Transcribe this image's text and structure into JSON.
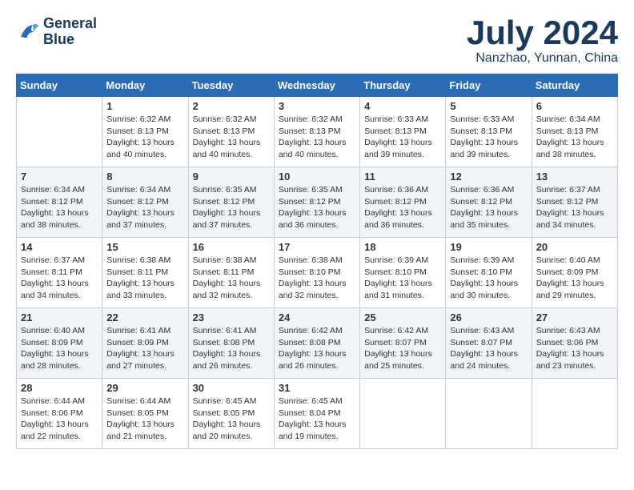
{
  "header": {
    "logo": {
      "line1": "General",
      "line2": "Blue"
    },
    "month": "July 2024",
    "location": "Nanzhao, Yunnan, China"
  },
  "days_of_week": [
    "Sunday",
    "Monday",
    "Tuesday",
    "Wednesday",
    "Thursday",
    "Friday",
    "Saturday"
  ],
  "weeks": [
    [
      {
        "day": "",
        "sunrise": "",
        "sunset": "",
        "daylight": ""
      },
      {
        "day": "1",
        "sunrise": "Sunrise: 6:32 AM",
        "sunset": "Sunset: 8:13 PM",
        "daylight": "Daylight: 13 hours and 40 minutes."
      },
      {
        "day": "2",
        "sunrise": "Sunrise: 6:32 AM",
        "sunset": "Sunset: 8:13 PM",
        "daylight": "Daylight: 13 hours and 40 minutes."
      },
      {
        "day": "3",
        "sunrise": "Sunrise: 6:32 AM",
        "sunset": "Sunset: 8:13 PM",
        "daylight": "Daylight: 13 hours and 40 minutes."
      },
      {
        "day": "4",
        "sunrise": "Sunrise: 6:33 AM",
        "sunset": "Sunset: 8:13 PM",
        "daylight": "Daylight: 13 hours and 39 minutes."
      },
      {
        "day": "5",
        "sunrise": "Sunrise: 6:33 AM",
        "sunset": "Sunset: 8:13 PM",
        "daylight": "Daylight: 13 hours and 39 minutes."
      },
      {
        "day": "6",
        "sunrise": "Sunrise: 6:34 AM",
        "sunset": "Sunset: 8:13 PM",
        "daylight": "Daylight: 13 hours and 38 minutes."
      }
    ],
    [
      {
        "day": "7",
        "sunrise": "Sunrise: 6:34 AM",
        "sunset": "Sunset: 8:12 PM",
        "daylight": "Daylight: 13 hours and 38 minutes."
      },
      {
        "day": "8",
        "sunrise": "Sunrise: 6:34 AM",
        "sunset": "Sunset: 8:12 PM",
        "daylight": "Daylight: 13 hours and 37 minutes."
      },
      {
        "day": "9",
        "sunrise": "Sunrise: 6:35 AM",
        "sunset": "Sunset: 8:12 PM",
        "daylight": "Daylight: 13 hours and 37 minutes."
      },
      {
        "day": "10",
        "sunrise": "Sunrise: 6:35 AM",
        "sunset": "Sunset: 8:12 PM",
        "daylight": "Daylight: 13 hours and 36 minutes."
      },
      {
        "day": "11",
        "sunrise": "Sunrise: 6:36 AM",
        "sunset": "Sunset: 8:12 PM",
        "daylight": "Daylight: 13 hours and 36 minutes."
      },
      {
        "day": "12",
        "sunrise": "Sunrise: 6:36 AM",
        "sunset": "Sunset: 8:12 PM",
        "daylight": "Daylight: 13 hours and 35 minutes."
      },
      {
        "day": "13",
        "sunrise": "Sunrise: 6:37 AM",
        "sunset": "Sunset: 8:12 PM",
        "daylight": "Daylight: 13 hours and 34 minutes."
      }
    ],
    [
      {
        "day": "14",
        "sunrise": "Sunrise: 6:37 AM",
        "sunset": "Sunset: 8:11 PM",
        "daylight": "Daylight: 13 hours and 34 minutes."
      },
      {
        "day": "15",
        "sunrise": "Sunrise: 6:38 AM",
        "sunset": "Sunset: 8:11 PM",
        "daylight": "Daylight: 13 hours and 33 minutes."
      },
      {
        "day": "16",
        "sunrise": "Sunrise: 6:38 AM",
        "sunset": "Sunset: 8:11 PM",
        "daylight": "Daylight: 13 hours and 32 minutes."
      },
      {
        "day": "17",
        "sunrise": "Sunrise: 6:38 AM",
        "sunset": "Sunset: 8:10 PM",
        "daylight": "Daylight: 13 hours and 32 minutes."
      },
      {
        "day": "18",
        "sunrise": "Sunrise: 6:39 AM",
        "sunset": "Sunset: 8:10 PM",
        "daylight": "Daylight: 13 hours and 31 minutes."
      },
      {
        "day": "19",
        "sunrise": "Sunrise: 6:39 AM",
        "sunset": "Sunset: 8:10 PM",
        "daylight": "Daylight: 13 hours and 30 minutes."
      },
      {
        "day": "20",
        "sunrise": "Sunrise: 6:40 AM",
        "sunset": "Sunset: 8:09 PM",
        "daylight": "Daylight: 13 hours and 29 minutes."
      }
    ],
    [
      {
        "day": "21",
        "sunrise": "Sunrise: 6:40 AM",
        "sunset": "Sunset: 8:09 PM",
        "daylight": "Daylight: 13 hours and 28 minutes."
      },
      {
        "day": "22",
        "sunrise": "Sunrise: 6:41 AM",
        "sunset": "Sunset: 8:09 PM",
        "daylight": "Daylight: 13 hours and 27 minutes."
      },
      {
        "day": "23",
        "sunrise": "Sunrise: 6:41 AM",
        "sunset": "Sunset: 8:08 PM",
        "daylight": "Daylight: 13 hours and 26 minutes."
      },
      {
        "day": "24",
        "sunrise": "Sunrise: 6:42 AM",
        "sunset": "Sunset: 8:08 PM",
        "daylight": "Daylight: 13 hours and 26 minutes."
      },
      {
        "day": "25",
        "sunrise": "Sunrise: 6:42 AM",
        "sunset": "Sunset: 8:07 PM",
        "daylight": "Daylight: 13 hours and 25 minutes."
      },
      {
        "day": "26",
        "sunrise": "Sunrise: 6:43 AM",
        "sunset": "Sunset: 8:07 PM",
        "daylight": "Daylight: 13 hours and 24 minutes."
      },
      {
        "day": "27",
        "sunrise": "Sunrise: 6:43 AM",
        "sunset": "Sunset: 8:06 PM",
        "daylight": "Daylight: 13 hours and 23 minutes."
      }
    ],
    [
      {
        "day": "28",
        "sunrise": "Sunrise: 6:44 AM",
        "sunset": "Sunset: 8:06 PM",
        "daylight": "Daylight: 13 hours and 22 minutes."
      },
      {
        "day": "29",
        "sunrise": "Sunrise: 6:44 AM",
        "sunset": "Sunset: 8:05 PM",
        "daylight": "Daylight: 13 hours and 21 minutes."
      },
      {
        "day": "30",
        "sunrise": "Sunrise: 6:45 AM",
        "sunset": "Sunset: 8:05 PM",
        "daylight": "Daylight: 13 hours and 20 minutes."
      },
      {
        "day": "31",
        "sunrise": "Sunrise: 6:45 AM",
        "sunset": "Sunset: 8:04 PM",
        "daylight": "Daylight: 13 hours and 19 minutes."
      },
      {
        "day": "",
        "sunrise": "",
        "sunset": "",
        "daylight": ""
      },
      {
        "day": "",
        "sunrise": "",
        "sunset": "",
        "daylight": ""
      },
      {
        "day": "",
        "sunrise": "",
        "sunset": "",
        "daylight": ""
      }
    ]
  ]
}
